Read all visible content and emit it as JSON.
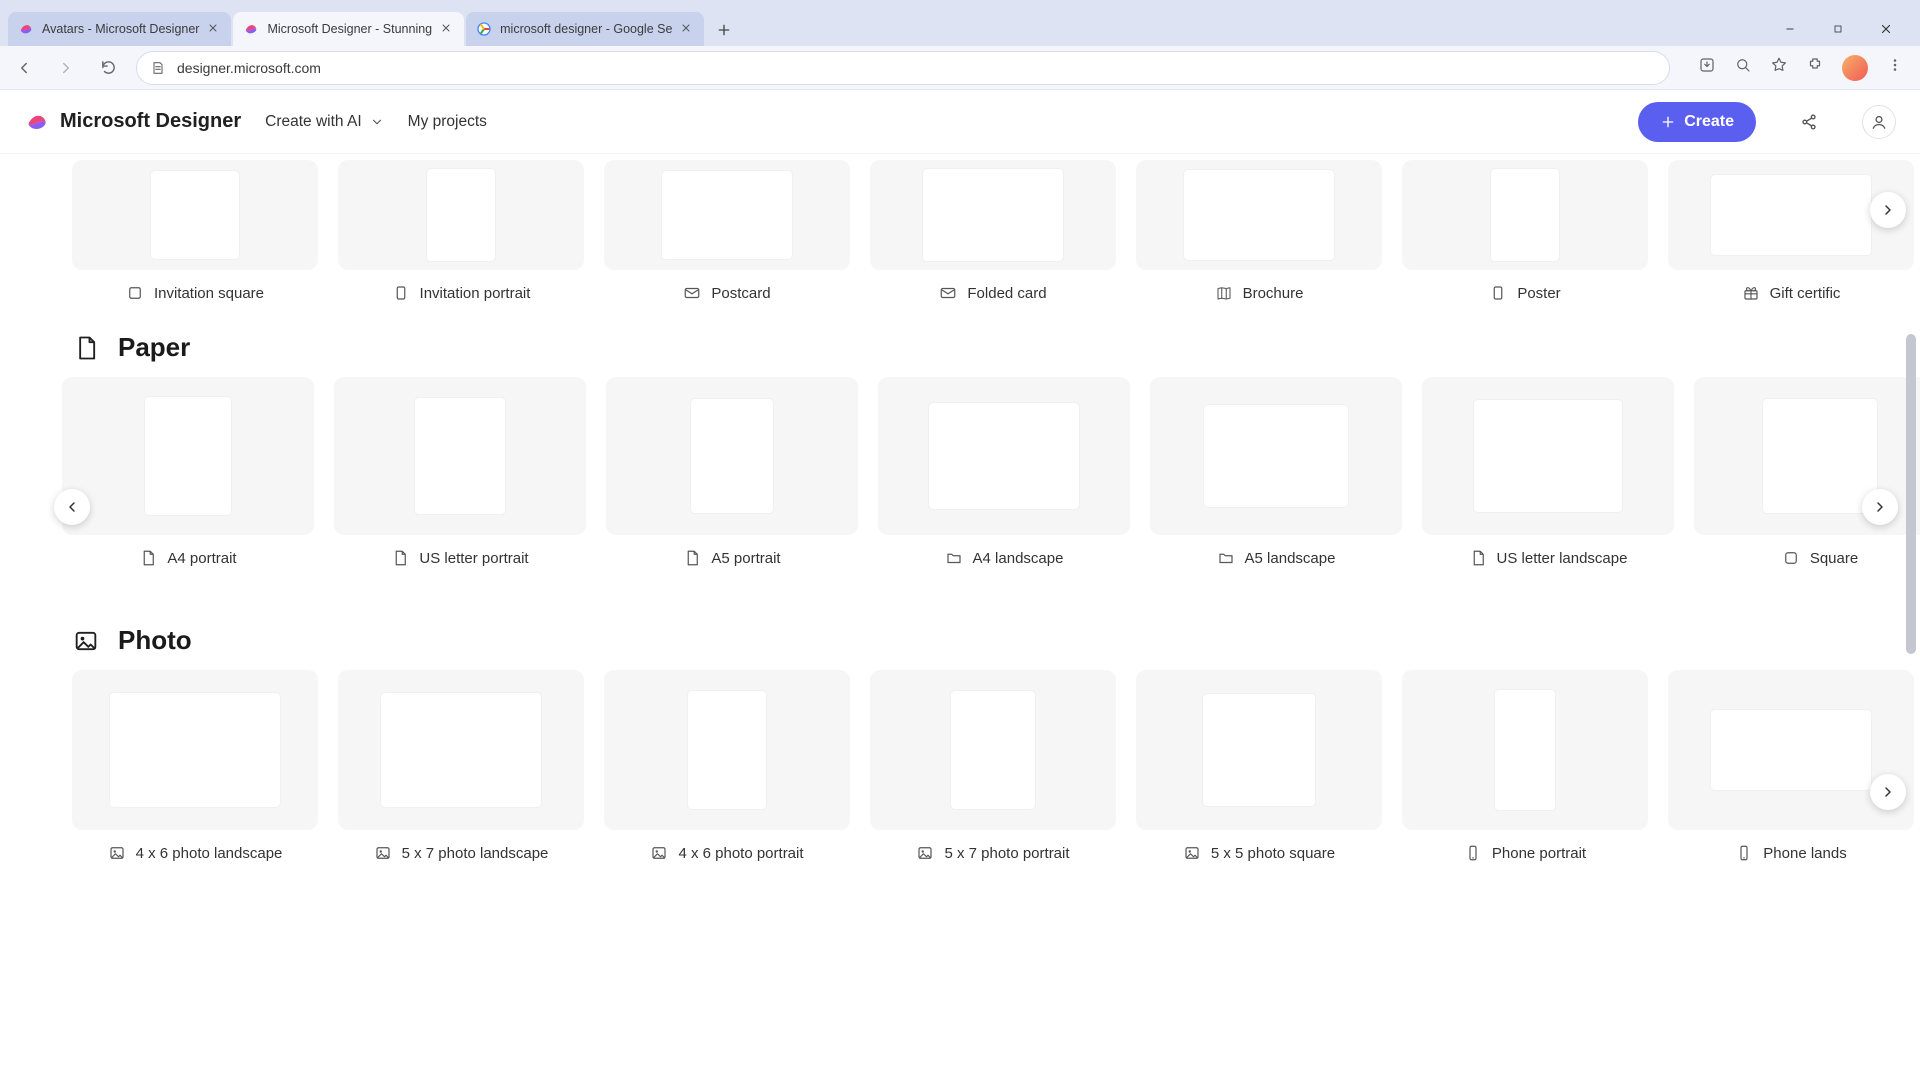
{
  "browser": {
    "tabs": [
      {
        "title": "microsoft designer - Google Se",
        "favicon": "google",
        "active": false
      },
      {
        "title": "Microsoft Designer - Stunning",
        "favicon": "designer",
        "active": true
      },
      {
        "title": "Avatars - Microsoft Designer",
        "favicon": "designer",
        "active": false
      }
    ],
    "url": "designer.microsoft.com"
  },
  "header": {
    "app_title": "Microsoft Designer",
    "create_with_ai": "Create with AI",
    "my_projects": "My projects",
    "create_button": "Create"
  },
  "rows": {
    "top": {
      "items": [
        {
          "label": "Invitation square",
          "icon": "square",
          "thumb_w": 88,
          "thumb_h": 88
        },
        {
          "label": "Invitation portrait",
          "icon": "portrait",
          "thumb_w": 68,
          "thumb_h": 92
        },
        {
          "label": "Postcard",
          "icon": "mail",
          "thumb_w": 130,
          "thumb_h": 88
        },
        {
          "label": "Folded card",
          "icon": "mail",
          "thumb_w": 140,
          "thumb_h": 92
        },
        {
          "label": "Brochure",
          "icon": "brochure",
          "thumb_w": 150,
          "thumb_h": 90
        },
        {
          "label": "Poster",
          "icon": "portrait",
          "thumb_w": 68,
          "thumb_h": 92
        },
        {
          "label": "Gift certific",
          "icon": "gift",
          "thumb_w": 160,
          "thumb_h": 80
        }
      ]
    },
    "paper": {
      "title": "Paper",
      "items": [
        {
          "label": "A4 portrait",
          "icon": "doc",
          "thumb_w": 86,
          "thumb_h": 118
        },
        {
          "label": "US letter portrait",
          "icon": "doc",
          "thumb_w": 90,
          "thumb_h": 116
        },
        {
          "label": "A5 portrait",
          "icon": "doc",
          "thumb_w": 82,
          "thumb_h": 114
        },
        {
          "label": "A4 landscape",
          "icon": "folder",
          "thumb_w": 150,
          "thumb_h": 106
        },
        {
          "label": "A5 landscape",
          "icon": "folder",
          "thumb_w": 144,
          "thumb_h": 102
        },
        {
          "label": "US letter landscape",
          "icon": "doc",
          "thumb_w": 148,
          "thumb_h": 112
        },
        {
          "label": "Square",
          "icon": "square-o",
          "thumb_w": 114,
          "thumb_h": 114
        }
      ]
    },
    "photo": {
      "title": "Photo",
      "items": [
        {
          "label": "4 x 6 photo landscape",
          "icon": "image",
          "thumb_w": 170,
          "thumb_h": 114
        },
        {
          "label": "5 x 7 photo landscape",
          "icon": "image",
          "thumb_w": 160,
          "thumb_h": 114
        },
        {
          "label": "4 x 6 photo portrait",
          "icon": "image",
          "thumb_w": 78,
          "thumb_h": 118
        },
        {
          "label": "5 x 7 photo portrait",
          "icon": "image",
          "thumb_w": 84,
          "thumb_h": 118
        },
        {
          "label": "5 x 5 photo square",
          "icon": "image",
          "thumb_w": 112,
          "thumb_h": 112
        },
        {
          "label": "Phone portrait",
          "icon": "phone",
          "thumb_w": 60,
          "thumb_h": 120
        },
        {
          "label": "Phone lands",
          "icon": "phone",
          "thumb_w": 160,
          "thumb_h": 80
        }
      ]
    }
  }
}
